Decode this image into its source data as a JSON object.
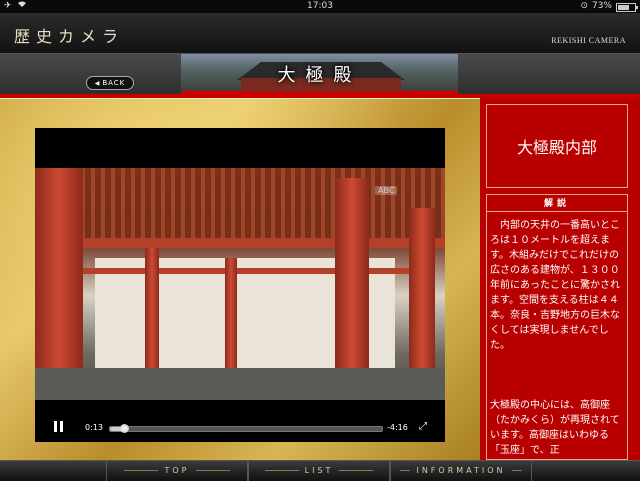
{
  "status_bar": {
    "time": "17:03",
    "battery": "73%",
    "battery_level": 0.73,
    "icons": [
      "airplane-icon",
      "wifi-icon",
      "rotation-lock-icon",
      "battery-icon"
    ]
  },
  "header": {
    "title": "歴史カメラ",
    "title_en": "REKISHI CAMERA"
  },
  "subbar": {
    "back_label": "BACK",
    "banner_title": "大極殿"
  },
  "video": {
    "watermark": "ABC",
    "current_time": "0:13",
    "remaining_time": "-4:16",
    "progress": 0.05,
    "icons": [
      "pause-icon",
      "fullscreen-icon"
    ]
  },
  "side_panel": {
    "title": "大極殿内部",
    "heading": "解説",
    "paragraph1": "内部の天井の一番高いところは１０メートルを超えます。木組みだけでこれだけの広さのある建物が、１３００年前にあったことに驚かされます。空間を支える柱は４４本。奈良・吉野地方の巨木なくしては実現しませんでした。",
    "paragraph2": "大極殿の中心には、高御座（たかみくら）が再現されています。高御座はいわゆる「玉座」で、正"
  },
  "tabs": [
    {
      "label": "TOP"
    },
    {
      "label": "LIST"
    },
    {
      "label": "INFORMATION"
    }
  ],
  "colors": {
    "accent_red": "#c40000",
    "gold": "#d8b553",
    "panel_red": "#b80000"
  }
}
